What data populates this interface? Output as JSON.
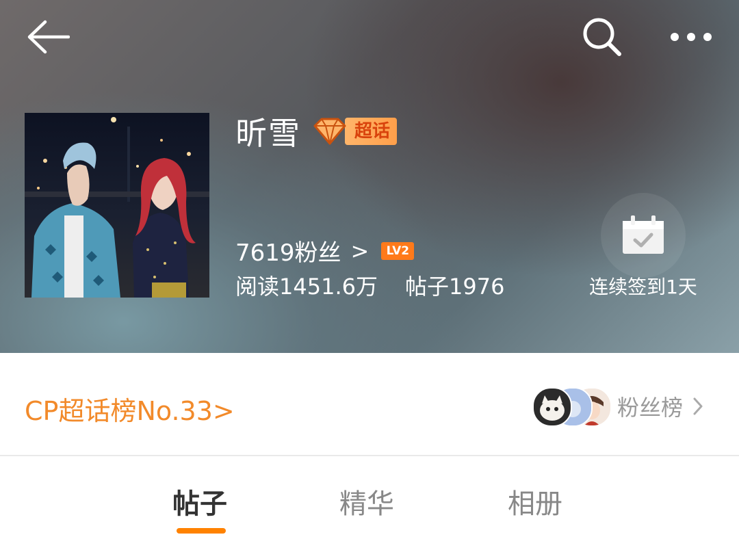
{
  "header": {
    "title": "昕雪",
    "super_badge": "超话",
    "fans_count": "7619粉丝",
    "fans_arrow": ">",
    "level_badge": "LV2",
    "reads": "阅读1451.6万",
    "posts": "帖子1976",
    "checkin_label": "连续签到1天"
  },
  "rank_bar": {
    "cp_rank_link": "CP超话榜No.33>",
    "fans_rank_label": "粉丝榜"
  },
  "tabs": [
    {
      "label": "帖子",
      "active": true
    },
    {
      "label": "精华",
      "active": false
    },
    {
      "label": "相册",
      "active": false
    }
  ],
  "icons": {
    "back": "back-arrow-icon",
    "search": "search-icon",
    "more": "more-dots-icon",
    "checkin": "calendar-check-icon",
    "gem": "diamond-icon",
    "chevron": "chevron-right-icon"
  },
  "colors": {
    "accent_orange": "#ff8200",
    "cp_link": "#f28a2a",
    "badge_text": "#d9430c"
  }
}
